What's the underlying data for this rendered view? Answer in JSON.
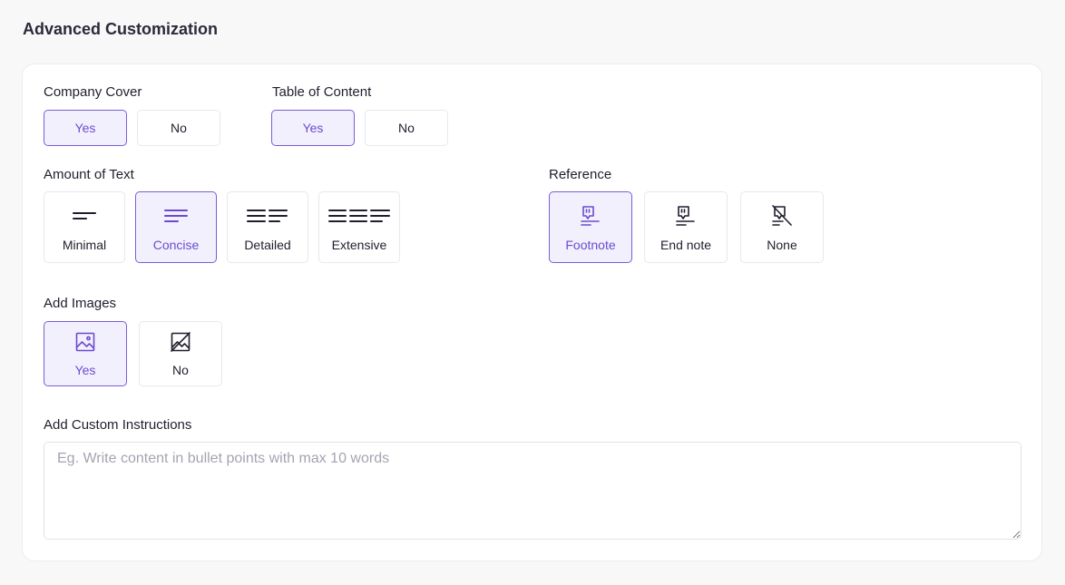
{
  "page": {
    "title": "Advanced Customization"
  },
  "company_cover": {
    "label": "Company Cover",
    "options": [
      "Yes",
      "No"
    ],
    "selected": "Yes"
  },
  "table_of_content": {
    "label": "Table of Content",
    "options": [
      "Yes",
      "No"
    ],
    "selected": "Yes"
  },
  "amount_of_text": {
    "label": "Amount of Text",
    "options": [
      "Minimal",
      "Concise",
      "Detailed",
      "Extensive"
    ],
    "selected": "Concise"
  },
  "reference": {
    "label": "Reference",
    "options": [
      "Footnote",
      "End note",
      "None"
    ],
    "selected": "Footnote"
  },
  "add_images": {
    "label": "Add Images",
    "options": [
      "Yes",
      "No"
    ],
    "selected": "Yes"
  },
  "custom_instructions": {
    "label": "Add Custom Instructions",
    "placeholder": "Eg. Write content in bullet points with max 10 words",
    "value": ""
  },
  "colors": {
    "accent": "#7c5cd6",
    "accent_bg": "#f3f0fd",
    "dark": "#1f1f2e"
  }
}
